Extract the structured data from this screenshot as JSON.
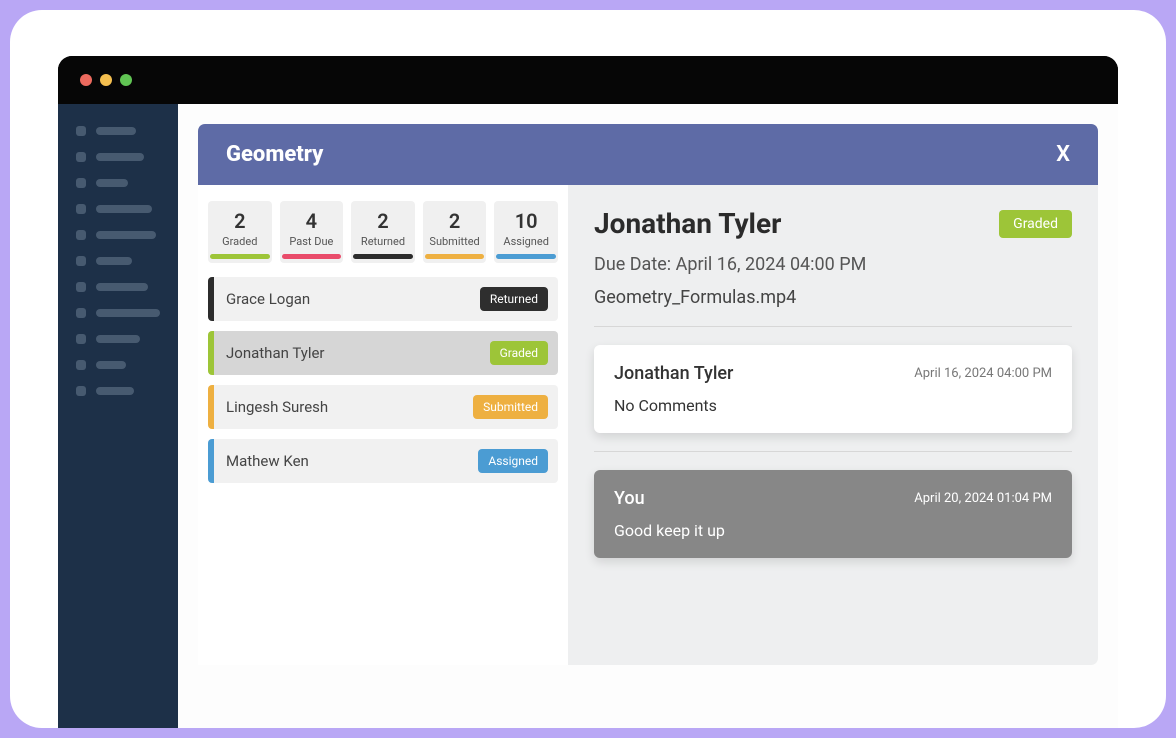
{
  "panel": {
    "title": "Geometry",
    "close": "X"
  },
  "stats": [
    {
      "count": "2",
      "label": "Graded",
      "barClass": "bar-green"
    },
    {
      "count": "4",
      "label": "Past Due",
      "barClass": "bar-red"
    },
    {
      "count": "2",
      "label": "Returned",
      "barClass": "bar-dark"
    },
    {
      "count": "2",
      "label": "Submitted",
      "barClass": "bar-amber"
    },
    {
      "count": "10",
      "label": "Assigned",
      "barClass": "bar-blue"
    }
  ],
  "students": [
    {
      "name": "Grace Logan",
      "status": "Returned",
      "badgeClass": "badge-dark",
      "stripeClass": "stripe-dark",
      "selected": false
    },
    {
      "name": "Jonathan Tyler",
      "status": "Graded",
      "badgeClass": "badge-green",
      "stripeClass": "stripe-green",
      "selected": true
    },
    {
      "name": "Lingesh Suresh",
      "status": "Submitted",
      "badgeClass": "badge-amber",
      "stripeClass": "stripe-amber",
      "selected": false
    },
    {
      "name": "Mathew Ken",
      "status": "Assigned",
      "badgeClass": "badge-blue",
      "stripeClass": "stripe-blue",
      "selected": false
    }
  ],
  "detail": {
    "name": "Jonathan Tyler",
    "statusLabel": "Graded",
    "dueLine": "Due Date: April 16, 2024 04:00 PM",
    "file": "Geometry_Formulas.mp4"
  },
  "comments": [
    {
      "author": "Jonathan Tyler",
      "ts": "April 16, 2024 04:00 PM",
      "body": "No Comments",
      "style": "white"
    },
    {
      "author": "You",
      "ts": "April 20, 2024 01:04 PM",
      "body": "Good keep it up",
      "style": "grey"
    }
  ],
  "navLineWidths": [
    40,
    48,
    32,
    56,
    60,
    36,
    52,
    64,
    44,
    30,
    38
  ]
}
